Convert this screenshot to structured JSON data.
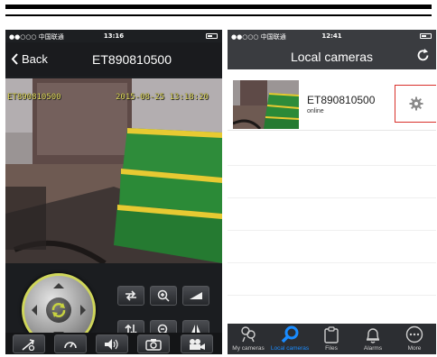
{
  "left_screen": {
    "status": {
      "carrier": "●●○○○ 中国联通 ",
      "time": "13:16"
    },
    "nav": {
      "back_label": "Back",
      "title": "ET890810500"
    },
    "video": {
      "osd_id": "ET890810500",
      "osd_time": "2015-08-25 13:18:20"
    }
  },
  "right_screen": {
    "status": {
      "carrier": "●●○○○ 中国联通 ",
      "time": "12:41"
    },
    "nav": {
      "title": "Local cameras"
    },
    "camera": {
      "name": "ET890810500",
      "status": "online"
    },
    "tabs": [
      {
        "label": "My cameras",
        "icon": "cameras-icon"
      },
      {
        "label": "Local cameras",
        "icon": "search-icon"
      },
      {
        "label": "Files",
        "icon": "clipboard-icon"
      },
      {
        "label": "Alarms",
        "icon": "bell-icon"
      },
      {
        "label": "More",
        "icon": "more-icon"
      }
    ],
    "active_tab": "Local cameras"
  },
  "colors": {
    "accent": "#1a8cff",
    "highlight": "#d9302b",
    "joystick_ring": "#cfd65a"
  }
}
